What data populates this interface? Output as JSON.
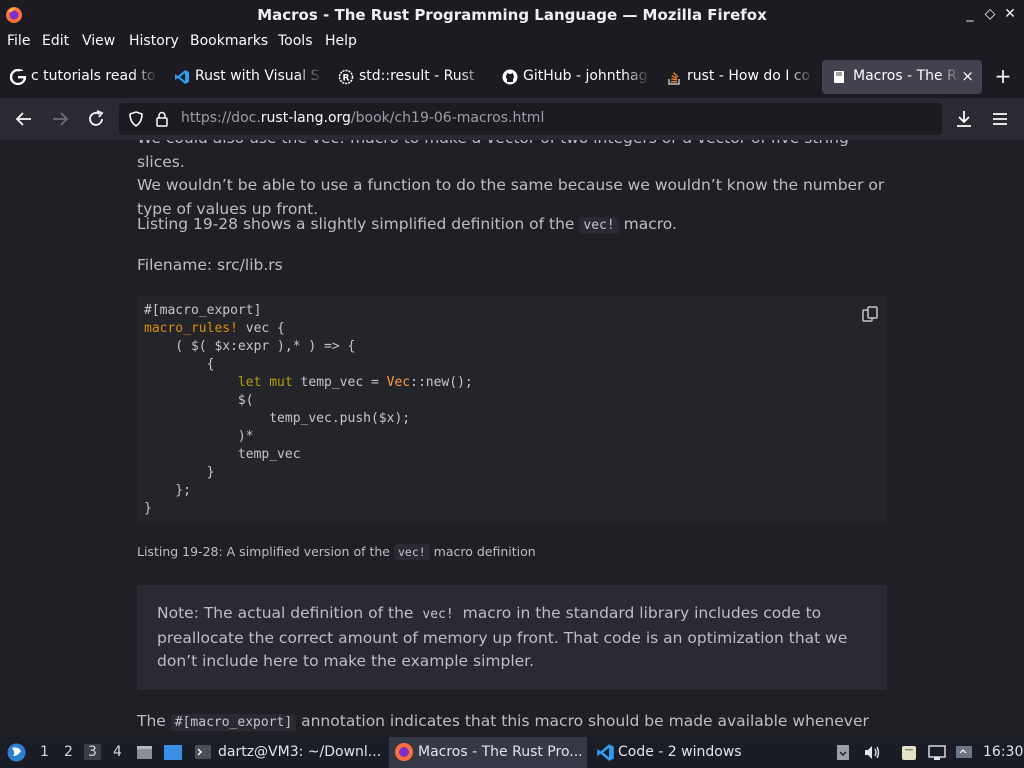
{
  "window": {
    "title": "Macros - The Rust Programming Language — Mozilla Firefox",
    "minimize_glyph": "_",
    "maximize_glyph": "◇",
    "close_glyph": "✕"
  },
  "menu": {
    "items": [
      "File",
      "Edit",
      "View",
      "History",
      "Bookmarks",
      "Tools",
      "Help"
    ]
  },
  "tabs": [
    {
      "label": "c tutorials read to",
      "icon": "google-icon"
    },
    {
      "label": "Rust with Visual S",
      "icon": "vscode-icon"
    },
    {
      "label": "std::result - Rust",
      "icon": "rust-icon"
    },
    {
      "label": "GitHub - johnthag",
      "icon": "github-icon"
    },
    {
      "label": "rust - How do I co",
      "icon": "stackoverflow-icon"
    },
    {
      "label": "Macros - The Ru",
      "icon": "book-icon",
      "active": true
    }
  ],
  "newtab_glyph": "+",
  "tab_close_glyph": "×",
  "urlbar": {
    "url_prefix": "https://doc.",
    "url_domain": "rust-lang.org",
    "url_path": "/book/ch19-06-macros.html"
  },
  "page": {
    "para1_line1": "We could also use the vec! macro to make a vector of two integers or a vector of five string slices.",
    "para1_rest": "We wouldn’t be able to use a function to do the same because we wouldn’t know the number or type of values up front.",
    "para2_before": "Listing 19-28 shows a slightly simplified definition of the",
    "para2_code": "vec!",
    "para2_after": "macro.",
    "filename": "Filename: src/lib.rs",
    "caption_before": "Listing 19-28: A simplified version of the",
    "caption_code": "vec!",
    "caption_after": "macro definition",
    "note_before": "Note: The actual definition of the",
    "note_code": "vec!",
    "note_after": "macro in the standard library includes code to preallocate the correct amount of memory up front. That code is an optimization that we don’t include here to make the example simpler.",
    "para3_before": "The",
    "para3_code": "#[macro_export]",
    "para3_after": "annotation indicates that this macro should be made available whenever the"
  },
  "code": {
    "l1": "#[macro_export]",
    "l2_kw": "macro_rules!",
    "l2_rest": " vec {",
    "l3": "    ( $( $x:expr ),* ) => {",
    "l4": "        {",
    "l5_kw": "            let mut",
    "l5_mid": " temp_vec = ",
    "l5_ty": "Vec",
    "l5_end": "::new();",
    "l6": "            $(",
    "l7": "                temp_vec.push($x);",
    "l8": "            )*",
    "l9": "            temp_vec",
    "l10": "        }",
    "l11": "    };",
    "l12": "}"
  },
  "taskbar": {
    "workspaces": [
      "1",
      "2",
      "3",
      "4"
    ],
    "active_workspace": "3",
    "tasks": [
      {
        "label": "dartz@VM3: ~/Downl...",
        "icon": "terminal-icon"
      },
      {
        "label": "Macros - The Rust Pro...",
        "icon": "firefox-icon",
        "active": true
      },
      {
        "label": "Code - 2 windows",
        "icon": "vscode-icon"
      }
    ],
    "clock": "16:30"
  }
}
